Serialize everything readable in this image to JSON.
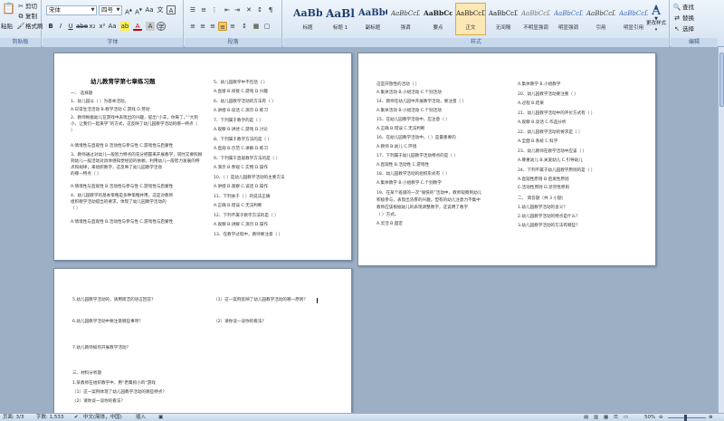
{
  "clipboard": {
    "paste": "粘贴",
    "cut": "剪切",
    "copy": "复制",
    "format_painter": "格式刷",
    "group": "剪贴板"
  },
  "font": {
    "name": "宋体",
    "size": "四号",
    "group": "字体"
  },
  "paragraph": {
    "group": "段落"
  },
  "styles": {
    "group": "样式",
    "items": [
      {
        "sample": "AaBbC",
        "name": "标题"
      },
      {
        "sample": "AaBl",
        "name": "标题 1"
      },
      {
        "sample": "AaBbC",
        "name": "副标题"
      },
      {
        "sample": "AaBbCcDt",
        "name": "强调"
      },
      {
        "sample": "AaBbCcD",
        "name": "要点"
      },
      {
        "sample": "AaBbCcDt",
        "name": "正文"
      },
      {
        "sample": "AaBbCcDt",
        "name": "无间隔"
      },
      {
        "sample": "AaBbCcDt",
        "name": "不明显强调"
      },
      {
        "sample": "AaBbCcDt",
        "name": "明显强调"
      },
      {
        "sample": "AaBbCcDt",
        "name": "引用"
      },
      {
        "sample": "AaBbCcDt",
        "name": "明显引用"
      }
    ],
    "change_styles": "更改样式"
  },
  "editing": {
    "find": "查找",
    "replace": "替换",
    "select": "选择",
    "group": "编辑"
  },
  "page1": {
    "left": [
      "幼儿教育学第七章练习题",
      "一、  选择题",
      "1、幼儿园以（  ）为基本活动。",
      "  A.日常生活活动   B.教学活动   C.游戏   D.劳动",
      "2、教师根据幼儿在游戏中表现出的兴趣，提出“小羊，你来了。”“大狗",
      "小，让我们一起来学”的方式，这反映了幼儿园教学活动的哪一特点（",
      "）",
      "  A.情境性与直观性   B.活动性与参与性   C.游戏性与启蒙性",
      "3、教师通过对幼儿一般智力特点的充分把握来开展教学，同时又要照顾",
      "到幼儿一般活动对具体感知觉经验的依赖，利用幼儿一般智力发展的特",
      "点和规律，来组织教学，这反映了幼儿园教学活动",
      "的哪一特点（  ）",
      "  A.情境性与直观性   B.活动性与参与性   C.游戏性与启蒙性",
      "4、幼儿园教学的基本策略是多种策略并用，这是对教师",
      "组织教学活动提出的要求，体现了幼儿园教学活动的",
      "（  ）",
      "  A.情境性与直观性   B.活动性与参与性   C.游戏性与启蒙性"
    ],
    "right": [
      "5、幼儿园教学中不包括（  ）",
      "  A.直接   B.间接   C.游戏   D.兴趣",
      "6、幼儿园教学活动的方法有（  ）",
      "  A.讲授   B.谈话   C.演示   D.练习",
      "7、下列属于教学的是（  ）",
      "  A.观察   B.讲述   C.游戏   D.讨论",
      "8、下列属于教学方法的是（  ）",
      "  A.直观   B.示范   C.讲解   D.练习",
      "9、下列属于直观教学方法的是（  ）",
      "  A.演示   B.参观   C.实物   D.操作",
      "10、（  ）是幼儿园教学活动的主要方法",
      "  A.讲授   B.观察   C.谈话   D.操作",
      "11、下列关于（  ）的说法正确",
      "  A.正确   B.错误   C.无法判断",
      "12、下列不属于教学方法的是（  ）",
      "  A.观察   B.讲解   C.演示   D.操作",
      "13、在教学过程中，教师要注意（  ）"
    ]
  },
  "page2": {
    "left": [
      "这是开放性的活动（  ）",
      "  A.集体活动   B.小组活动   C.个别活动",
      "14、教师在幼儿园中开展教学活动，要注意（  ）",
      "  A.集体活动   B.小组活动   C.个别活动",
      "15、在幼儿园教学活动中，应注意（  ）",
      "  A.正确   B.错误   C.无法判断",
      "16、在幼儿园教学活动中，（  ）是最重要的",
      "  A.教师   B.幼儿   C.环境",
      "17、下列属于幼儿园教学活动特点的是（  ）",
      "  A.直观性   B.活动性   C.游戏性",
      "18、幼儿园教学活动的组织形式有（  ）",
      "  A.集体教学   B.小组教学   C.个别教学",
      "19、在某个班级的一次“愉快的”活动中，教师观察到幼儿",
      "积极参与，表现出浓厚的兴趣，但有的幼儿注意力不集中",
      "教师应该根据幼儿的表现调整教学，这说明了教学",
      "（  ）方式。",
      "  A.灵活   B.固定"
    ],
    "right": [
      "  A.集体教学   B.小组教学",
      "20、幼儿园教学活动要注重（  ）",
      "  A.过程   B.结果",
      "21、幼儿园教学活动中的评价方式有（  ）",
      "  A.观察   B.谈话   C.作品分析",
      "22、幼儿园教学活动的要求是（  ）",
      "  A.全面   B.系统   C.科学",
      "23、幼儿教师在教学活动中应该（  ）",
      "  A.尊重幼儿   B.关爱幼儿   C.引导幼儿",
      "24、下列不属于幼儿园教学原则的是（  ）",
      "  A.直观性原则   B.启发性原则",
      "  C.活动性原则   D.惩罚性原则",
      "二、  简答题（共 3 小题）",
      "1.幼儿园教学活动的含义？",
      "2.幼儿园教学活动的特点是什么？",
      "3.幼儿园教学活动的方法有哪些？"
    ]
  },
  "page3": {
    "left": [
      "5.幼儿园教学活动的，请用简洁的语言回答？",
      "6.幼儿园教学活动中要注意哪些事项？",
      "7.幼儿教师如何开展教学活动？",
      "三、材料分析题",
      "1.某教师在组织教学中，用“老鹰抓小鸡”游戏",
      "（1）这一案例体现了幼儿园教学活动的哪些特点？",
      "（2）请你谈一谈你的看法？"
    ],
    "right": [
      "（1）这一案例反映了幼儿园教学活动的哪一原则？",
      "（2）请你谈一谈你的看法？"
    ]
  },
  "status": {
    "page": "页面: 3/3",
    "words": "字数: 1,533",
    "language": "中文(简体，中国)",
    "mode": "插入",
    "zoom": "50%"
  }
}
